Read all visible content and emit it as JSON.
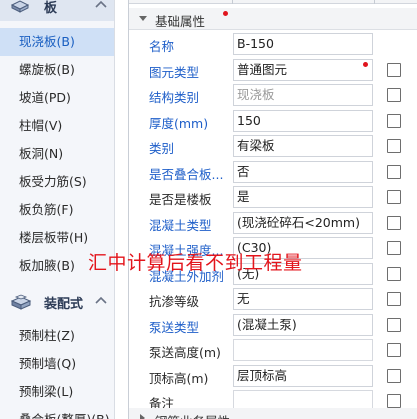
{
  "left_nav": {
    "ban_category": {
      "label": "板",
      "icon": "slab-icon",
      "chevron": "chevron-up-icon"
    },
    "ban_items": [
      {
        "label": "现浇板(B)",
        "selected": true
      },
      {
        "label": "螺旋板(B)",
        "selected": false
      },
      {
        "label": "坡道(PD)",
        "selected": false
      },
      {
        "label": "柱帽(V)",
        "selected": false
      },
      {
        "label": "板洞(N)",
        "selected": false
      },
      {
        "label": "板受力筋(S)",
        "selected": false
      },
      {
        "label": "板负筋(F)",
        "selected": false
      },
      {
        "label": "楼层板带(H)",
        "selected": false
      },
      {
        "label": "板加腋(B)",
        "selected": false
      }
    ],
    "prefab_category": {
      "label": "装配式",
      "icon": "prefab-icon",
      "chevron": "chevron-up-icon"
    },
    "prefab_items": [
      {
        "label": "预制柱(Z)"
      },
      {
        "label": "预制墙(Q)"
      },
      {
        "label": "预制梁(L)"
      },
      {
        "label": "叠合板(整厚)(B)"
      }
    ]
  },
  "panel": {
    "group_basic": "基础属性",
    "rows": [
      {
        "name": "名称",
        "value": "B-150",
        "name_color": "blue",
        "value_style": "normal",
        "checkbox": false
      },
      {
        "name": "图元类型",
        "value": "普通图元",
        "name_color": "blue",
        "value_style": "normal",
        "checkbox": true
      },
      {
        "name": "结构类别",
        "value": "现浇板",
        "name_color": "blue",
        "value_style": "gray",
        "checkbox": true
      },
      {
        "name": "厚度(mm)",
        "value": "150",
        "name_color": "blue",
        "value_style": "normal",
        "checkbox": true
      },
      {
        "name": "类别",
        "value": "有梁板",
        "name_color": "blue",
        "value_style": "normal",
        "checkbox": true
      },
      {
        "name": "是否叠合板...",
        "value": "否",
        "name_color": "blue",
        "value_style": "normal",
        "checkbox": true
      },
      {
        "name": "是否是楼板",
        "value": "是",
        "name_color": "black",
        "value_style": "normal",
        "checkbox": true
      },
      {
        "name": "混凝土类型",
        "value": "(现浇砼碎石<20mm)",
        "name_color": "blue",
        "value_style": "normal",
        "checkbox": true
      },
      {
        "name": "混凝土强度...",
        "value": "(C30)",
        "name_color": "blue",
        "value_style": "normal",
        "checkbox": true
      },
      {
        "name": "混凝土外加剂",
        "value": "(无)",
        "name_color": "blue",
        "value_style": "normal",
        "checkbox": true
      },
      {
        "name": "抗渗等级",
        "value": "无",
        "name_color": "black",
        "value_style": "normal",
        "checkbox": true
      },
      {
        "name": "泵送类型",
        "value": "(混凝土泵)",
        "name_color": "blue",
        "value_style": "normal",
        "checkbox": true
      },
      {
        "name": "泵送高度(m)",
        "value": "",
        "name_color": "black",
        "value_style": "empty",
        "checkbox": true
      },
      {
        "name": "顶标高(m)",
        "value": "层顶标高",
        "name_color": "black",
        "value_style": "normal",
        "checkbox": true
      },
      {
        "name": "备注",
        "value": "",
        "name_color": "black",
        "value_style": "empty",
        "checkbox": true
      }
    ],
    "group_next": "钢筋业务属性"
  },
  "overlay_text": "汇中计算后看不到工程量",
  "colors": {
    "accent_blue": "#1f5fc9",
    "marker_red": "#e0141d",
    "selected_bg": "#cfe0f6"
  }
}
